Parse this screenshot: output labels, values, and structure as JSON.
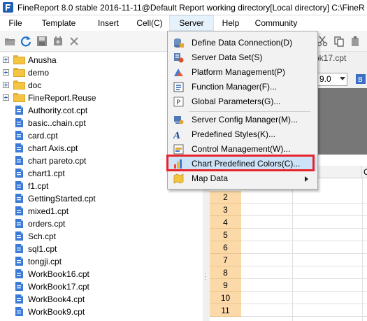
{
  "window": {
    "title": "FineReport 8.0 stable 2016-11-11@Default Report working directory[Local directory]   C:\\FineR"
  },
  "menubar": {
    "items": [
      {
        "label": "File",
        "active": false
      },
      {
        "label": "Template",
        "active": false
      },
      {
        "label": "Insert",
        "active": false
      },
      {
        "label": "Cell(C)",
        "active": false
      },
      {
        "label": "Server",
        "active": true
      },
      {
        "label": "Help",
        "active": false
      },
      {
        "label": "Community",
        "active": false
      }
    ]
  },
  "toolbar": {
    "icons": [
      "folder-open-icon",
      "refresh-icon",
      "save-icon",
      "settings-icon",
      "delete-icon"
    ]
  },
  "tree": {
    "folders": [
      "Anusha",
      "demo",
      "doc",
      "FineReport.Reuse"
    ],
    "files": [
      "Authority.cot.cpt",
      "basic..chain.cpt",
      "card.cpt",
      "chart Axis.cpt",
      "chart pareto.cpt",
      "chart1.cpt",
      "f1.cpt",
      "GettingStarted.cpt",
      "mixed1.cpt",
      "orders.cpt",
      "Sch.cpt",
      "sql1.cpt",
      "tongji.cpt",
      "WorkBook16.cpt",
      "WorkBook17.cpt",
      "WorkBook4.cpt",
      "WorkBook9.cpt"
    ]
  },
  "editor": {
    "file_tab": "ok17.cpt",
    "font_size": "9.0",
    "column_letter": "C",
    "row_numbers": [
      "2",
      "3",
      "4",
      "5",
      "6",
      "7",
      "8",
      "9",
      "10",
      "11"
    ]
  },
  "server_menu": {
    "items": [
      {
        "label": "Define Data Connection(D)",
        "icon": "database-connection-icon"
      },
      {
        "label": "Server Data Set(S)",
        "icon": "server-dataset-icon"
      },
      {
        "label": "Platform Management(P)",
        "icon": "platform-icon"
      },
      {
        "label": "Function Manager(F)...",
        "icon": "function-icon"
      },
      {
        "label": "Global Parameters(G)...",
        "icon": "parameter-icon"
      },
      {
        "label": "Server Config Manager(M)...",
        "icon": "config-icon"
      },
      {
        "label": "Predefined Styles(K)...",
        "icon": "style-icon"
      },
      {
        "label": "Control Management(W)...",
        "icon": "control-icon"
      },
      {
        "label": "Chart Predefined Colors(C)...",
        "icon": "chart-colors-icon",
        "highlighted": true
      },
      {
        "label": "Map Data",
        "icon": "map-icon",
        "submenu": true
      }
    ]
  },
  "colors": {
    "highlight_box": "#e8242b",
    "row_header": "#fbd9a8",
    "menu_bg": "#f2f2f2"
  }
}
